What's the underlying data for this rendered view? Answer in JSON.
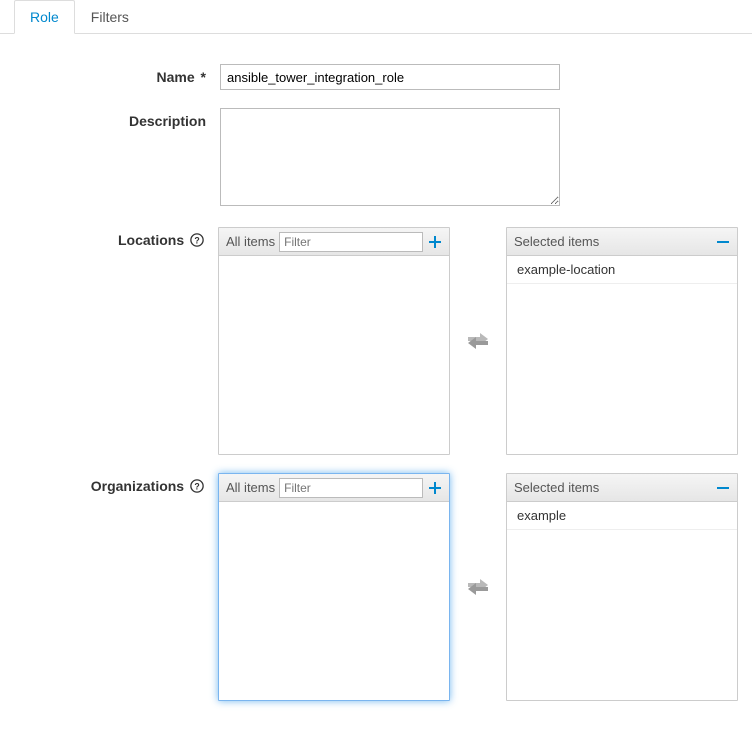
{
  "tabs": {
    "role": "Role",
    "filters": "Filters"
  },
  "form": {
    "name_label": "Name",
    "required_marker": "*",
    "name_value": "ansible_tower_integration_role",
    "description_label": "Description",
    "description_value": "",
    "locations_label": "Locations",
    "organizations_label": "Organizations"
  },
  "multiselect": {
    "all_items_label": "All items",
    "selected_items_label": "Selected items",
    "filter_placeholder": "Filter",
    "locations": {
      "available": [],
      "selected": [
        "example-location"
      ]
    },
    "organizations": {
      "available": [],
      "selected": [
        "example"
      ]
    }
  }
}
